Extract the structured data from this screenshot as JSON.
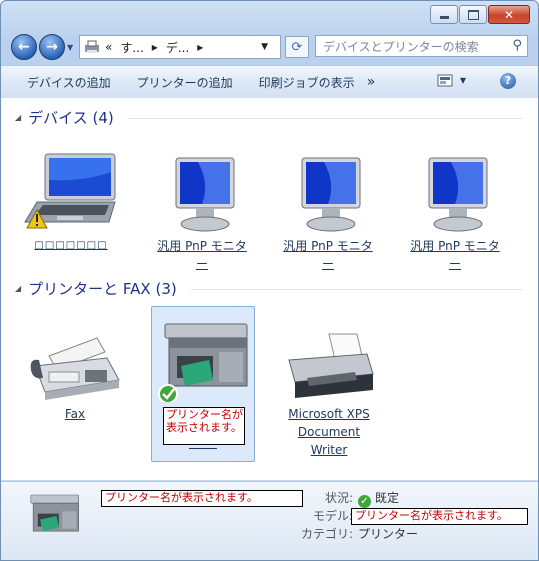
{
  "window": {
    "minimize": "–",
    "maximize": "□",
    "close": "✕"
  },
  "nav": {
    "back": "←",
    "forward": "→",
    "address_parts": [
      "«",
      "す...",
      "▸",
      "デ...",
      "▸"
    ],
    "address_dropdown": "▼",
    "refresh": "⟳",
    "search_placeholder": "デバイスとプリンターの検索"
  },
  "toolbar": {
    "add_device": "デバイスの追加",
    "add_printer": "プリンターの追加",
    "print_jobs": "印刷ジョブの表示",
    "more": "»",
    "view_dropdown": "▾",
    "help": "?"
  },
  "devices": {
    "header": "デバイス (4)",
    "items": [
      {
        "label": "□□□□□□□",
        "icon": "laptop-icon",
        "warning": true
      },
      {
        "label": "汎用 PnP モニター",
        "line1": "汎用 PnP モニタ",
        "line2": "ー",
        "icon": "monitor-icon"
      },
      {
        "label": "汎用 PnP モニター",
        "line1": "汎用 PnP モニタ",
        "line2": "ー",
        "icon": "monitor-icon"
      },
      {
        "label": "汎用 PnP モニター",
        "line1": "汎用 PnP モニタ",
        "line2": "ー",
        "icon": "monitor-icon"
      }
    ]
  },
  "printers": {
    "header": "プリンターと FAX (3)",
    "items": [
      {
        "label": "Fax",
        "icon": "fax-icon"
      },
      {
        "label": "プリンター名が表示されます。",
        "line1": "プリンター名が",
        "line2": "表示されます。",
        "icon": "multifunction-printer-icon",
        "default": true
      },
      {
        "label": "Microsoft XPS Document Writer",
        "line1": "Microsoft XPS",
        "line2": "Document",
        "line3": "Writer",
        "icon": "printer-icon"
      }
    ]
  },
  "details": {
    "name": "プリンター名が表示されます。",
    "status_label": "状況:",
    "status_value": "既定",
    "model_label": "モデル:",
    "model_value": "プリンター名が表示されます。",
    "category_label": "カテゴリ:",
    "category_value": "プリンター"
  },
  "colors": {
    "accent": "#1e3287",
    "selection": "#dbe9fb",
    "warning": "#f0c419",
    "check": "#3fa63a"
  }
}
